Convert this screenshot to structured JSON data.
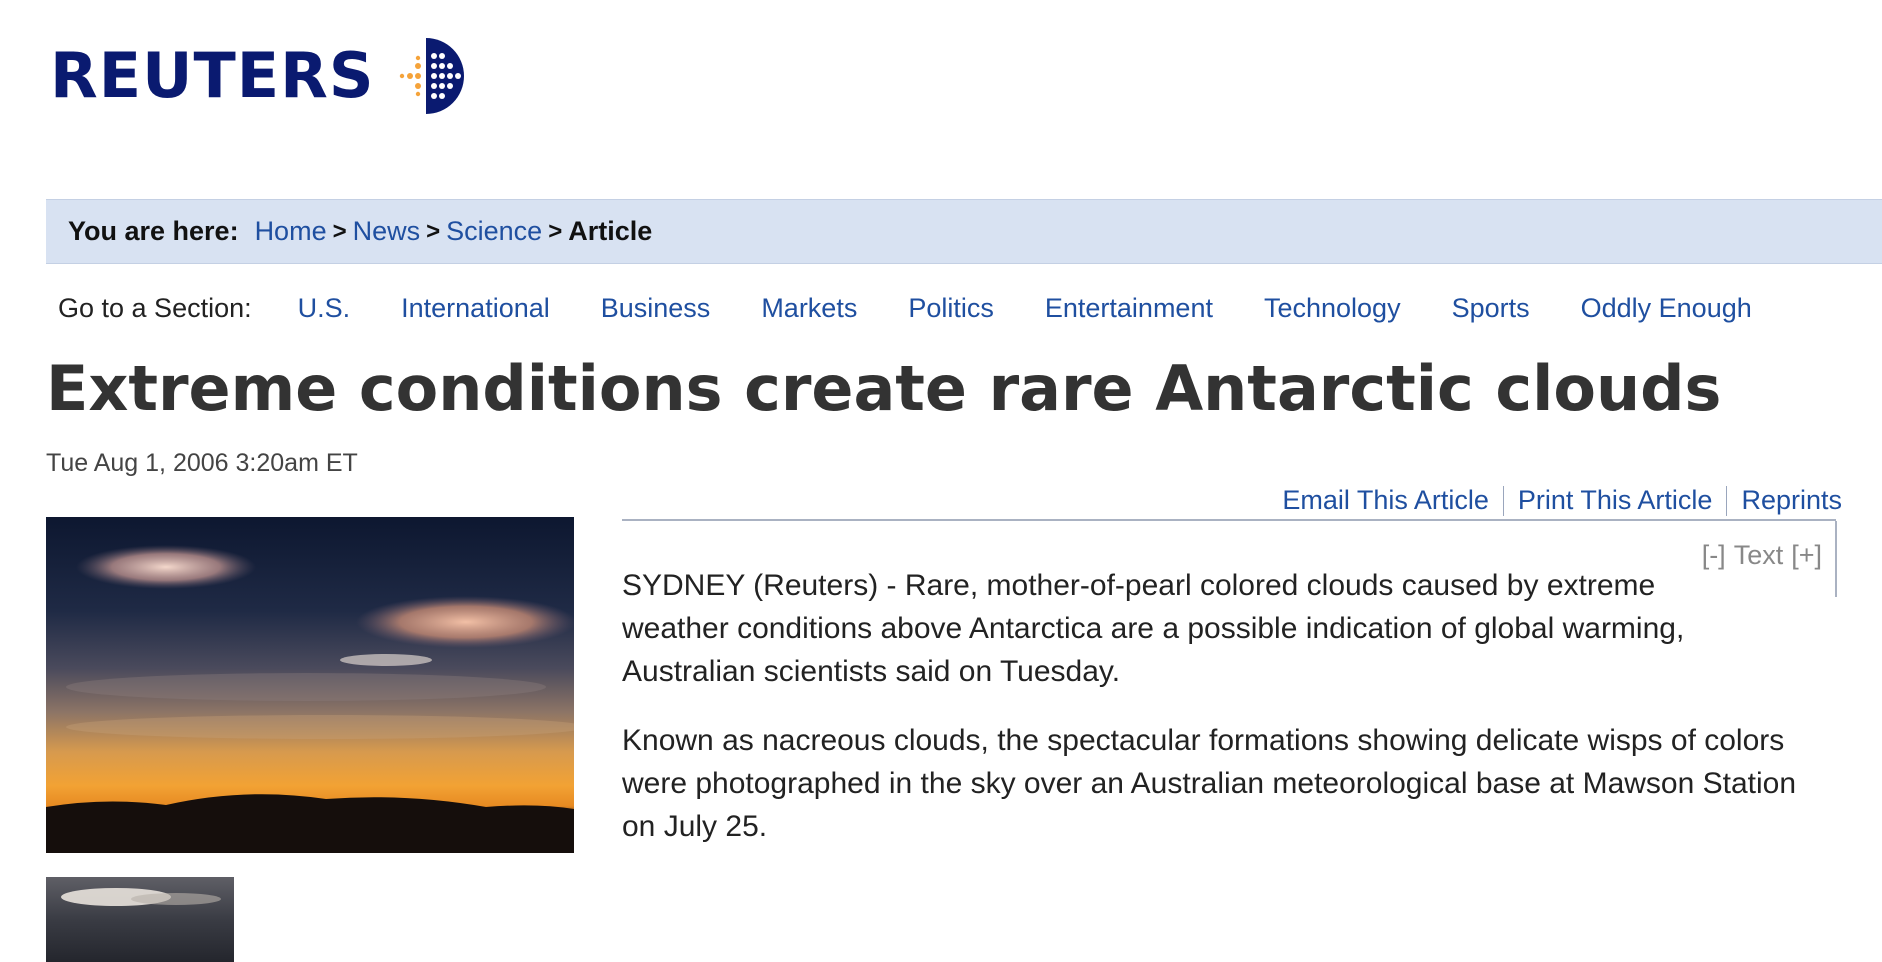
{
  "brand": {
    "name": "REUTERS",
    "colors": {
      "navy": "#0a1a70",
      "orange": "#f5a33a",
      "link": "#1f4fa0",
      "crumb_bg": "#d8e2f2"
    }
  },
  "breadcrumb": {
    "prefix": "You are here:",
    "items": [
      {
        "label": "Home"
      },
      {
        "label": "News"
      },
      {
        "label": "Science"
      }
    ],
    "separator": ">",
    "current": "Article"
  },
  "section_nav": {
    "label": "Go to a Section:",
    "items": [
      {
        "label": "U.S."
      },
      {
        "label": "International"
      },
      {
        "label": "Business"
      },
      {
        "label": "Markets"
      },
      {
        "label": "Politics"
      },
      {
        "label": "Entertainment"
      },
      {
        "label": "Technology"
      },
      {
        "label": "Sports"
      },
      {
        "label": "Oddly Enough"
      }
    ]
  },
  "article": {
    "headline": "Extreme conditions create rare Antarctic clouds",
    "dateline": "Tue Aug 1, 2006 3:20am ET",
    "tools": {
      "email": "Email This Article",
      "print": "Print This Article",
      "reprints": "Reprints"
    },
    "text_size": {
      "decrease": "[-]",
      "label": "Text",
      "increase": "[+]"
    },
    "paragraphs": [
      "SYDNEY (Reuters) - Rare, mother-of-pearl colored clouds caused by extreme weather conditions above Antarctica are a possible indication of global warming, Australian scientists said on Tuesday.",
      "Known as nacreous clouds, the spectacular formations showing delicate wisps of colors were photographed in the sky over an Australian meteorological base at Mawson Station on July 25."
    ]
  }
}
